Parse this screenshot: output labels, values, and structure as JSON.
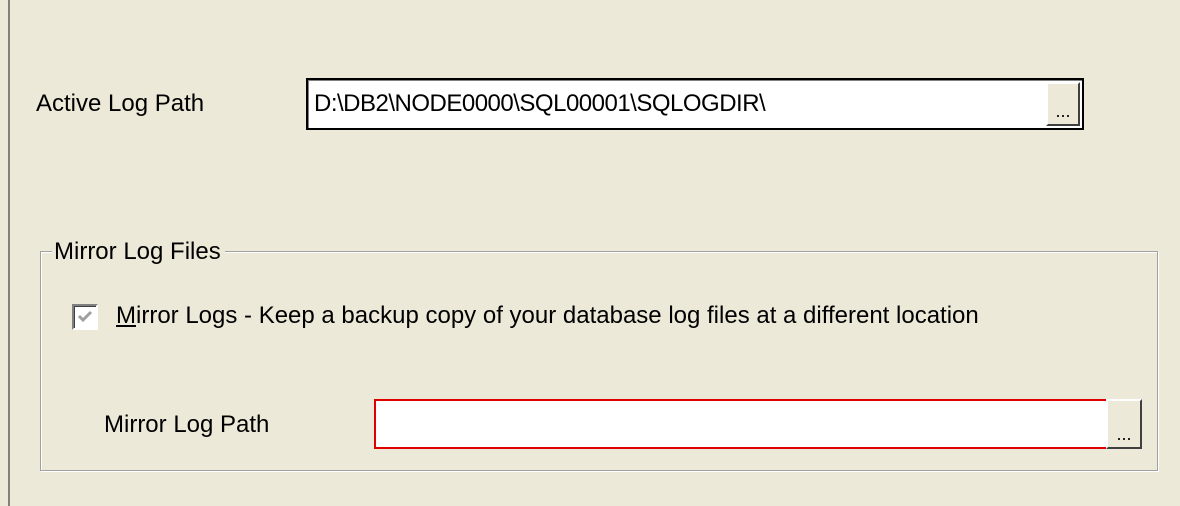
{
  "active_log": {
    "label": "Active Log Path",
    "value": "D:\\DB2\\NODE0000\\SQL00001\\SQLOGDIR\\",
    "browse_label": "..."
  },
  "mirror_group": {
    "title": "Mirror Log Files",
    "checkbox": {
      "checked": true,
      "mnemonic": "M",
      "label_rest": "irror Logs - Keep a backup copy of your database log files at a different location"
    },
    "mirror_path": {
      "label": "Mirror Log Path",
      "value": "",
      "browse_label": "..."
    }
  },
  "colors": {
    "background": "#ece9d8",
    "error_border": "#e00000"
  }
}
